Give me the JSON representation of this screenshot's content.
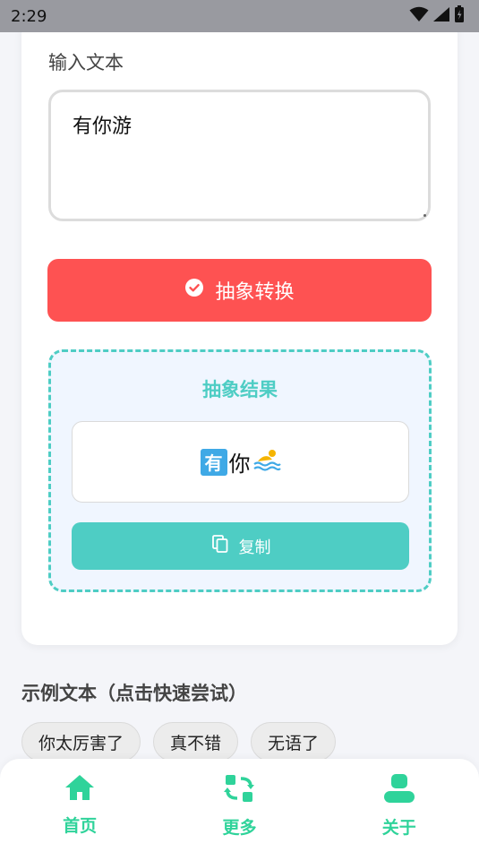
{
  "status_bar": {
    "time": "2:29",
    "icons": [
      "wifi-icon",
      "signal-icon",
      "battery-icon"
    ]
  },
  "input": {
    "label": "输入文本",
    "value": "有你游"
  },
  "convert_button": {
    "label": "抽象转换",
    "icon": "check-circle-icon",
    "color": "#fe5252"
  },
  "result": {
    "title": "抽象结果",
    "emoji_you": "有",
    "text": "你",
    "emoji_swim": "swimmer-emoji",
    "accent_color": "#4ecdc4"
  },
  "copy_button": {
    "label": "复制",
    "icon": "copy-icon"
  },
  "examples": {
    "title": "示例文本（点击快速尝试）",
    "items": [
      "你太厉害了",
      "真不错",
      "无语了"
    ]
  },
  "tabs": [
    {
      "label": "首页",
      "icon": "home-icon"
    },
    {
      "label": "更多",
      "icon": "swap-icon"
    },
    {
      "label": "关于",
      "icon": "user-icon"
    }
  ],
  "tab_color": "#2fd39a"
}
